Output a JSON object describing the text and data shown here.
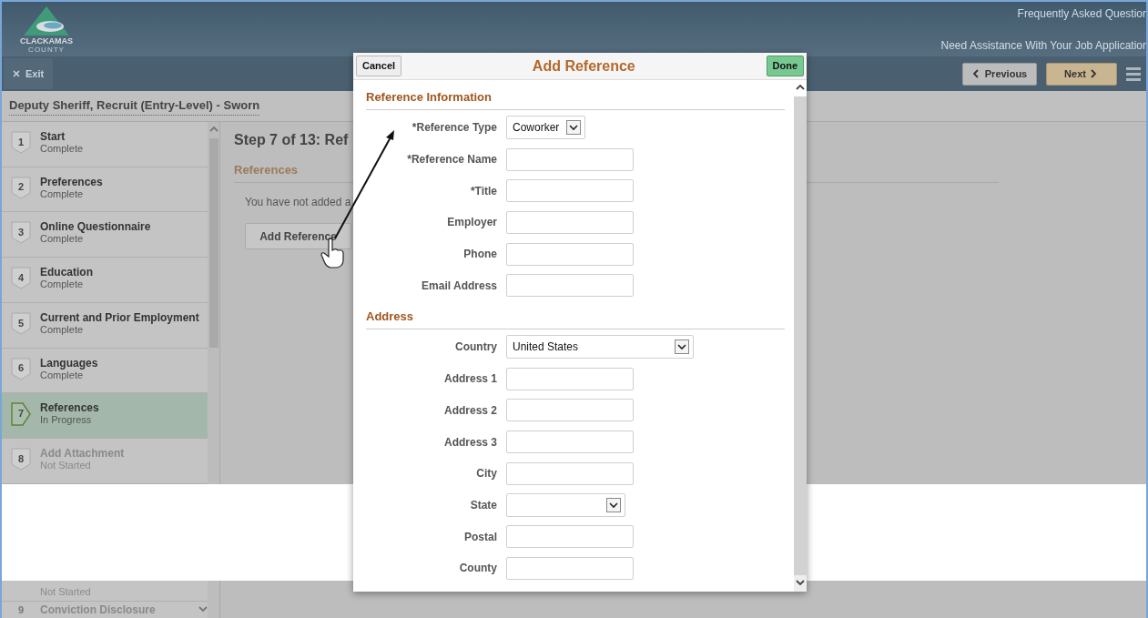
{
  "header": {
    "logo_text": "CLACKAMAS",
    "logo_subtext": "COUNTY",
    "links": [
      "Frequently Asked Questior",
      "Need Assistance With Your Job Applicatior"
    ]
  },
  "toolbar": {
    "exit": "Exit",
    "previous": "Previous",
    "next": "Next"
  },
  "job_title": "Deputy Sheriff, Recruit (Entry-Level) - Sworn",
  "steps": [
    {
      "number": "1",
      "title": "Start",
      "status": "Complete",
      "selected": false,
      "disabled": false
    },
    {
      "number": "2",
      "title": "Preferences",
      "status": "Complete",
      "selected": false,
      "disabled": false
    },
    {
      "number": "3",
      "title": "Online Questionnaire",
      "status": "Complete",
      "selected": false,
      "disabled": false
    },
    {
      "number": "4",
      "title": "Education",
      "status": "Complete",
      "selected": false,
      "disabled": false
    },
    {
      "number": "5",
      "title": "Current and Prior Employment",
      "status": "Complete",
      "selected": false,
      "disabled": false
    },
    {
      "number": "6",
      "title": "Languages",
      "status": "Complete",
      "selected": false,
      "disabled": false
    },
    {
      "number": "7",
      "title": "References",
      "status": "In Progress",
      "selected": true,
      "disabled": false
    },
    {
      "number": "8",
      "title": "Add Attachment",
      "status": "Not Started",
      "selected": false,
      "disabled": true
    }
  ],
  "steps_after_gap": [
    {
      "status": "Not Started"
    },
    {
      "number": "9",
      "title": "Conviction Disclosure"
    }
  ],
  "content": {
    "step_title": "Step 7 of 13: Ref",
    "section": "References",
    "message": "You have not added a",
    "add_button": "Add Reference"
  },
  "modal": {
    "cancel": "Cancel",
    "title": "Add Reference",
    "done": "Done",
    "sections": [
      {
        "heading": "Reference Information",
        "fields": [
          {
            "label": "*Reference Type",
            "kind": "select",
            "value": "Coworker"
          },
          {
            "label": "*Reference Name",
            "kind": "text"
          },
          {
            "label": "*Title",
            "kind": "text"
          },
          {
            "label": "Employer",
            "kind": "text"
          },
          {
            "label": "Phone",
            "kind": "text"
          },
          {
            "label": "Email Address",
            "kind": "text"
          }
        ]
      },
      {
        "heading": "Address",
        "fields": [
          {
            "label": "Country",
            "kind": "select",
            "value": "United States"
          },
          {
            "label": "Address 1",
            "kind": "text"
          },
          {
            "label": "Address 2",
            "kind": "text"
          },
          {
            "label": "Address 3",
            "kind": "text"
          },
          {
            "label": "City",
            "kind": "text"
          },
          {
            "label": "State",
            "kind": "select"
          },
          {
            "label": "Postal",
            "kind": "text"
          },
          {
            "label": "County",
            "kind": "text"
          }
        ]
      }
    ]
  }
}
